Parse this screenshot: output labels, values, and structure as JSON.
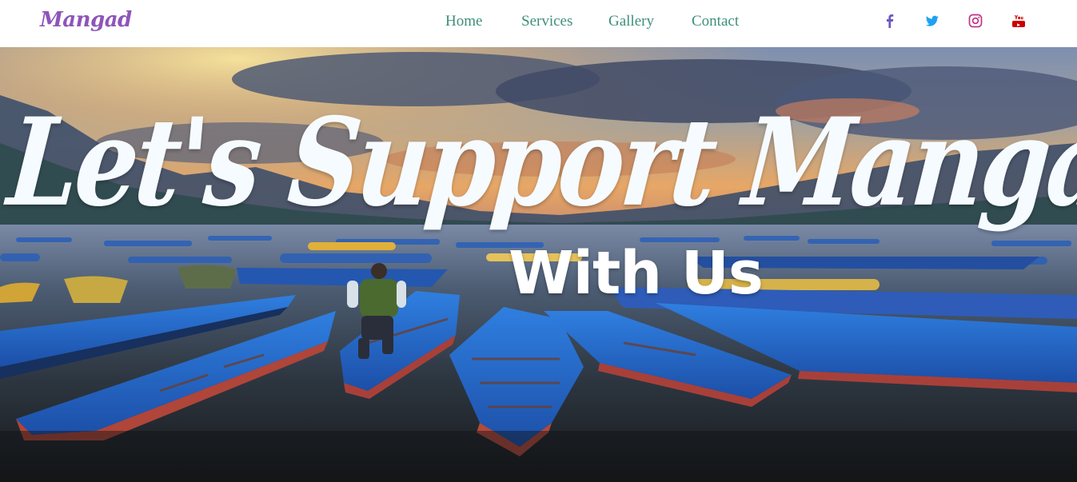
{
  "brand": {
    "name": "Mangad"
  },
  "nav": {
    "links": [
      {
        "label": "Home"
      },
      {
        "label": "Services"
      },
      {
        "label": "Gallery"
      },
      {
        "label": "Contact"
      }
    ]
  },
  "social": {
    "icons": [
      {
        "icon": "facebook-icon",
        "color": "#6f57c2"
      },
      {
        "icon": "twitter-icon",
        "color": "#1da1f2"
      },
      {
        "icon": "instagram-icon",
        "color": "#c13584"
      },
      {
        "icon": "youtube-icon",
        "color": "#cc0000"
      }
    ]
  },
  "hero": {
    "headline": "Let's Support Mangad WSUC",
    "subline": "With Us"
  },
  "colors": {
    "brand": "#8e55b8",
    "nav_link": "#3e8f7a",
    "hero_text": "#f6fbff"
  }
}
